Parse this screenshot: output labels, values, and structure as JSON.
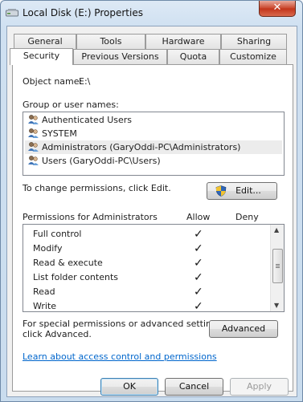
{
  "window": {
    "title": "Local Disk (E:) Properties",
    "close_glyph": "✕"
  },
  "tabs": {
    "row1": [
      "General",
      "Tools",
      "Hardware",
      "Sharing"
    ],
    "row2": [
      "Security",
      "Previous Versions",
      "Quota",
      "Customize"
    ],
    "active": "Security"
  },
  "security": {
    "object_name_label": "Object name:",
    "object_name_value": "E:\\",
    "group_label": "Group or user names:",
    "users": [
      {
        "name": "Authenticated Users",
        "icon": "user-group-icon"
      },
      {
        "name": "SYSTEM",
        "icon": "user-group-icon"
      },
      {
        "name": "Administrators (GaryOddi-PC\\Administrators)",
        "icon": "user-group-icon",
        "selected": true
      },
      {
        "name": "Users (GaryOddi-PC\\Users)",
        "icon": "user-group-icon"
      }
    ],
    "change_hint": "To change permissions, click Edit.",
    "edit_button": "Edit...",
    "permissions_for": "Permissions for Administrators",
    "allow_header": "Allow",
    "deny_header": "Deny",
    "permissions": [
      {
        "name": "Full control",
        "allow": "✓",
        "deny": ""
      },
      {
        "name": "Modify",
        "allow": "✓",
        "deny": ""
      },
      {
        "name": "Read & execute",
        "allow": "✓",
        "deny": ""
      },
      {
        "name": "List folder contents",
        "allow": "✓",
        "deny": ""
      },
      {
        "name": "Read",
        "allow": "✓",
        "deny": ""
      },
      {
        "name": "Write",
        "allow": "✓",
        "deny": ""
      }
    ],
    "special_line1": "For special permissions or advanced settings,",
    "special_line2": "click Advanced.",
    "advanced_button": "Advanced",
    "learn_link": "Learn about access control and permissions"
  },
  "footer": {
    "ok": "OK",
    "cancel": "Cancel",
    "apply": "Apply"
  },
  "colors": {
    "link": "#0066cc",
    "title_gradient_top": "#dde9f5",
    "close_red": "#c9452b"
  }
}
